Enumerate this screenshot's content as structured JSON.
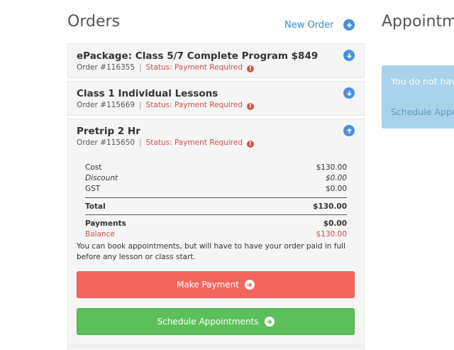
{
  "orders": {
    "title": "Orders",
    "new_order_label": "New Order",
    "items": [
      {
        "title": "ePackage: Class 5/7 Complete Program $849",
        "order_no": "Order #116355",
        "status": "Status: Payment Required"
      },
      {
        "title": "Class 1 Individual Lessons",
        "order_no": "Order #115669",
        "status": "Status: Payment Required"
      },
      {
        "title": "Pretrip 2 Hr",
        "order_no": "Order #115650",
        "status": "Status: Payment Required"
      }
    ],
    "separator": "|",
    "warn_glyph": "!",
    "expanded": {
      "cost_label": "Cost",
      "cost_value": "$130.00",
      "discount_label": "Discount",
      "discount_value": "$0.00",
      "gst_label": "GST",
      "gst_value": "$0.00",
      "total_label": "Total",
      "total_value": "$130.00",
      "payments_label": "Payments",
      "payments_value": "$0.00",
      "balance_label": "Balance",
      "balance_value": "$130.00",
      "note": "You can book appointments, but will have to have your order paid in full before any lesson or class start.",
      "make_payment_label": "Make Payment",
      "schedule_label": "Schedule Appointments"
    }
  },
  "appointments": {
    "title": "Appointme",
    "message": "You do not hav booked.",
    "link": "Schedule Appo"
  },
  "colors": {
    "accent_blue": "#4a90d9",
    "status_red": "#c9534f",
    "payment_button": "#f2665e",
    "schedule_button": "#5cbf5a",
    "appointment_box": "#a8d3ea"
  },
  "icons": {
    "new_order": "plus-circle-icon",
    "collapsed": "arrow-down-circle-icon",
    "expanded": "arrow-up-circle-icon",
    "status": "exclamation-circle-icon",
    "button": "arrow-right-circle-icon"
  }
}
